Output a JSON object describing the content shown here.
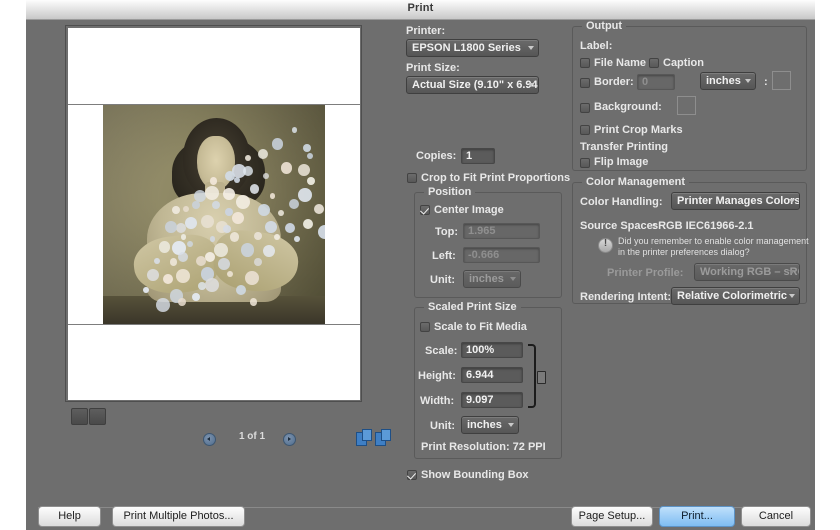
{
  "window": {
    "title": "Print"
  },
  "preview": {
    "page_indicator": "1 of 1",
    "prev_arrow_icon": "left-arrow-icon",
    "next_arrow_icon": "right-arrow-icon",
    "rotate_left_icon": "rotate-left-icon",
    "rotate_right_icon": "rotate-right-icon",
    "portrait_icon": "portrait-orientation-icon",
    "landscape_icon": "landscape-orientation-icon",
    "image_description": "Sepia vintage portrait photograph of a smiling woman with wavy dark hair, arms folded, overlaid with scattered pale circular dots"
  },
  "printer": {
    "label": "Printer:",
    "value": "EPSON L1800 Series"
  },
  "print_size": {
    "label": "Print Size:",
    "value": "Actual Size (9.10\" x 6.94"
  },
  "copies": {
    "label": "Copies:",
    "value": "1"
  },
  "crop_to_fit": {
    "label": "Crop to Fit Print Proportions",
    "checked": false
  },
  "position": {
    "caption": "Position",
    "center_image": {
      "label": "Center Image",
      "checked": true
    },
    "top": {
      "label": "Top:",
      "value": "1.965"
    },
    "left": {
      "label": "Left:",
      "value": "-0.666"
    },
    "unit": {
      "label": "Unit:",
      "value": "inches"
    }
  },
  "scaled_print_size": {
    "caption": "Scaled Print Size",
    "scale_to_fit": {
      "label": "Scale to Fit Media",
      "checked": false
    },
    "scale": {
      "label": "Scale:",
      "value": "100%"
    },
    "height": {
      "label": "Height:",
      "value": "6.944"
    },
    "width": {
      "label": "Width:",
      "value": "9.097"
    },
    "unit": {
      "label": "Unit:",
      "value": "inches"
    },
    "print_resolution": "Print Resolution: 72 PPI",
    "link_icon": "link-constrain-icon"
  },
  "show_bounding_box": {
    "label": "Show Bounding Box",
    "checked": true
  },
  "output": {
    "caption": "Output",
    "label_heading": "Label:",
    "file_name": {
      "label": "File Name",
      "checked": false
    },
    "caption_cb": {
      "label": "Caption",
      "checked": false
    },
    "border": {
      "label": "Border:",
      "checked": false,
      "value": "0",
      "unit": "inches",
      "colon": ":"
    },
    "background": {
      "label": "Background:",
      "checked": false
    },
    "print_crop_marks": {
      "label": "Print Crop Marks",
      "checked": false
    },
    "transfer_printing_heading": "Transfer Printing",
    "flip_image": {
      "label": "Flip Image",
      "checked": false
    }
  },
  "color_management": {
    "caption": "Color Management",
    "color_handling": {
      "label": "Color Handling:",
      "value": "Printer Manages Colors"
    },
    "source_space": {
      "label": "Source Space:",
      "value": "sRGB IEC61966-2.1"
    },
    "warning_icon": "warning-exclamation-icon",
    "warning_line1": "Did you remember to enable color management",
    "warning_line2": "in the printer preferences dialog?",
    "printer_profile": {
      "label": "Printer Profile:",
      "value": "Working RGB – sRGB IE("
    },
    "rendering_intent": {
      "label": "Rendering Intent:",
      "value": "Relative Colorimetric"
    }
  },
  "footer": {
    "help": "Help",
    "print_multiple": "Print Multiple Photos...",
    "page_setup": "Page Setup...",
    "print": "Print...",
    "cancel": "Cancel"
  }
}
